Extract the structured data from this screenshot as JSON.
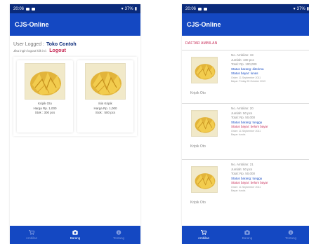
{
  "left_phone": {
    "status": {
      "time": "20:06",
      "battery": "37%"
    },
    "app_title": "CJS-Online",
    "user_label": "User Logged :",
    "user_name": "Toko Contoh",
    "logout_prompt": "Jika ingin logout klik ini :",
    "logout_label": "Logout",
    "products": [
      {
        "name": "Kripik Oto",
        "price": "Harga Rp. 1,000",
        "stock": "Stok : 300 pcs"
      },
      {
        "name": "Ikin Kripik",
        "price": "Harga Rp. 1,000",
        "stock": "Stok : 500 pcs"
      }
    ],
    "nav": [
      {
        "label": "Ambilan",
        "icon": "cart-icon",
        "active": false
      },
      {
        "label": "Barang",
        "icon": "camera-icon",
        "active": true
      },
      {
        "label": "Tentang",
        "icon": "info-icon",
        "active": false
      }
    ]
  },
  "right_phone": {
    "status": {
      "time": "20:06",
      "battery": "37%"
    },
    "app_title": "CJS-Online",
    "section_title": "DAFTAR AMBILAN",
    "orders": [
      {
        "product": "Kripik Oto",
        "no": "No. Ambilan: 19",
        "qty": "Jumlah: 100 pcs",
        "total": "Total: Rp. 100,000",
        "goods_status": "Status barang: diterima",
        "pay_status": "Status bayar: lunas",
        "ordered": "Order: 11 September 2011",
        "paid": "Bayar: Friday 25 October 2019"
      },
      {
        "product": "Kripik Oto",
        "no": "No. Ambilan: 20",
        "qty": "Jumlah: 50 pcs",
        "total": "Total: Rp. 50,000",
        "goods_status": "Status barang: tunggu",
        "pay_status": "Status bayar: belum bayar",
        "ordered": "Order: 11 September 2011",
        "paid": "Bayar: tunda"
      },
      {
        "product": "Kripik Oto",
        "no": "No. Ambilan: 21",
        "qty": "Jumlah: 50 pcs",
        "total": "Total: Rp. 50,000",
        "goods_status": "Status barang: tunggu",
        "pay_status": "Status bayar: belum bayar",
        "ordered": "Order: 11 September 2011",
        "paid": "Bayar: tunda"
      }
    ],
    "nav": [
      {
        "label": "Ambilan",
        "icon": "cart-icon",
        "active": true
      },
      {
        "label": "Barang",
        "icon": "camera-icon",
        "active": false
      },
      {
        "label": "Tentang",
        "icon": "info-icon",
        "active": false
      }
    ]
  },
  "colors": {
    "appbar": "#1448c2",
    "statusbar": "#0a2a7a",
    "accent_red": "#c62a56",
    "accent_blue": "#1448c2"
  }
}
